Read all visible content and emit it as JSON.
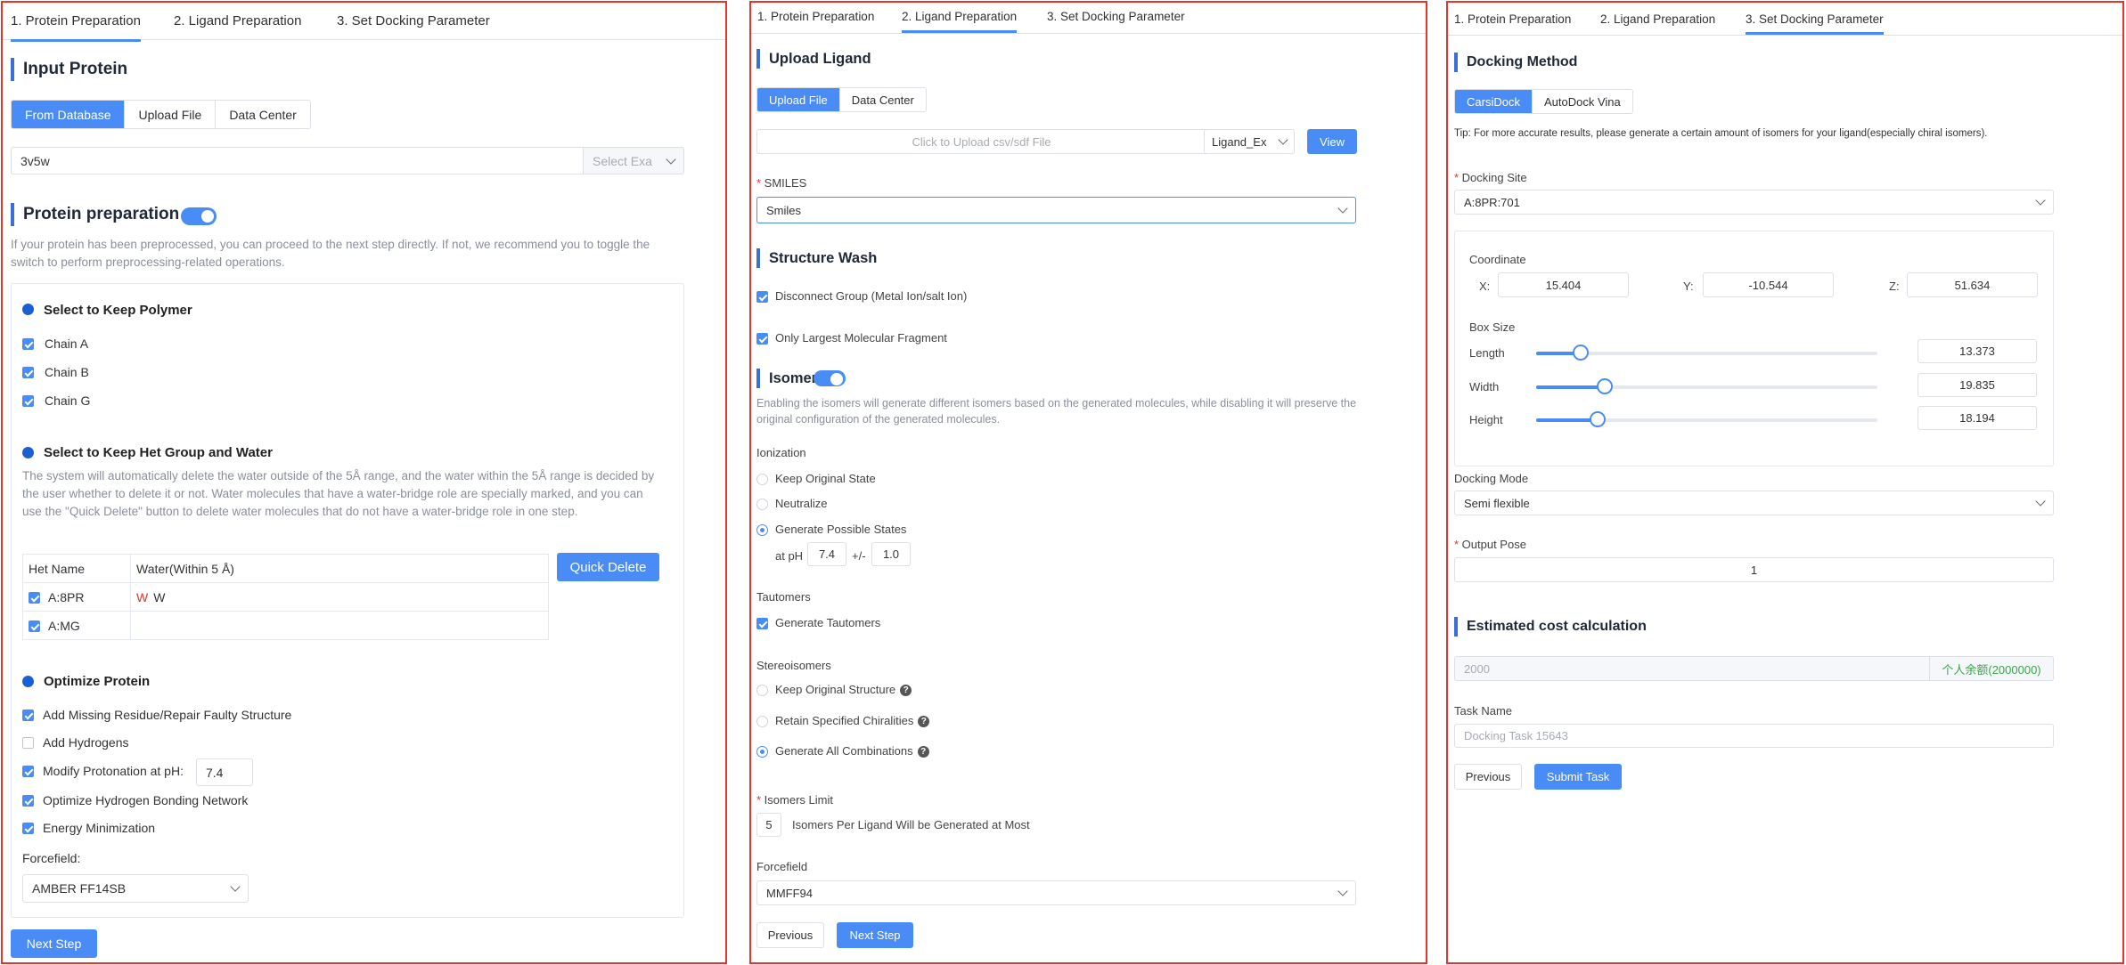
{
  "colors": {
    "accent": "#4a8cf6",
    "frame": "#e5342b",
    "success": "#3aa64a",
    "danger": "#e5342b"
  },
  "tabs": [
    "1. Protein Preparation",
    "2. Ligand Preparation",
    "3. Set Docking Parameter"
  ],
  "p1": {
    "input_protein_title": "Input Protein",
    "source_buttons": [
      "From Database",
      "Upload File",
      "Data Center"
    ],
    "pdb_id": "3v5w",
    "example_select": "Select Exa",
    "prep_title": "Protein preparation",
    "prep_desc": "If your protein has been preprocessed, you can proceed to the next step directly. If not, we recommend you to toggle the switch to perform preprocessing-related operations.",
    "polymer_title": "Select to Keep Polymer",
    "chains": [
      "Chain A",
      "Chain B",
      "Chain G"
    ],
    "het_title": "Select to Keep Het Group and Water",
    "het_desc": "The system will automatically delete the water outside of the 5Å range, and the water within the 5Å range is decided by the user whether to delete it or not. Water molecules that have a water-bridge role are specially marked, and you can use the \"Quick Delete\" button to delete water molecules that do not have a water-bridge role in one step.",
    "het_table": {
      "headers": [
        "Het Name",
        "Water(Within 5 Å)"
      ],
      "rows": [
        {
          "name": "A:8PR",
          "w_red": "W",
          "w": "W"
        },
        {
          "name": "A:MG",
          "w_red": "",
          "w": ""
        }
      ]
    },
    "quick_delete": "Quick Delete",
    "optimize_title": "Optimize Protein",
    "options": [
      {
        "label": "Add Missing Residue/Repair Faulty Structure",
        "checked": true
      },
      {
        "label": "Add Hydrogens",
        "checked": false
      },
      {
        "label": "Modify Protonation at pH:",
        "checked": true
      },
      {
        "label": "Optimize Hydrogen Bonding Network",
        "checked": true
      },
      {
        "label": "Energy Minimization",
        "checked": true
      }
    ],
    "ph_value": "7.4",
    "forcefield_label": "Forcefield:",
    "forcefield_value": "AMBER FF14SB",
    "next_button": "Next Step"
  },
  "p2": {
    "upload_title": "Upload Ligand",
    "source_buttons": [
      "Upload File",
      "Data Center"
    ],
    "upload_placeholder": "Click to Upload csv/sdf File",
    "example_select": "Ligand_Ex",
    "view_button": "View",
    "smiles_label": "SMILES",
    "smiles_value": "Smiles",
    "wash_title": "Structure Wash",
    "wash_options": [
      "Disconnect Group (Metal Ion/salt Ion)",
      "Only Largest Molecular Fragment"
    ],
    "isomers_title": "Isomers",
    "isomers_desc": "Enabling the isomers will generate different isomers based on the generated molecules, while disabling it will preserve the original configuration of the generated molecules.",
    "ionization_label": "Ionization",
    "ionization_options": [
      "Keep Original State",
      "Neutralize",
      "Generate Possible States"
    ],
    "at_ph": "at pH",
    "ph": "7.4",
    "pm": "+/-",
    "ph_range": "1.0",
    "tautomers_label": "Tautomers",
    "tautomers_option": "Generate Tautomers",
    "stereo_label": "Stereoisomers",
    "stereo_options": [
      "Keep Original Structure",
      "Retain Specified Chiralities",
      "Generate All Combinations"
    ],
    "limit_label": "Isomers Limit",
    "limit_value": "5",
    "limit_suffix": "Isomers Per Ligand Will be Generated at Most",
    "forcefield_label": "Forcefield",
    "forcefield_value": "MMFF94",
    "previous": "Previous",
    "next": "Next Step"
  },
  "p3": {
    "method_title": "Docking Method",
    "methods": [
      "CarsiDock",
      "AutoDock Vina"
    ],
    "tip": "Tip: For more accurate results, please generate a certain amount of isomers for your ligand(especially chiral isomers).",
    "site_label": "Docking Site",
    "site_value": "A:8PR:701",
    "coordinate_label": "Coordinate",
    "x_label": "X:",
    "x": "15.404",
    "y_label": "Y:",
    "y": "-10.544",
    "z_label": "Z:",
    "z": "51.634",
    "box_label": "Box Size",
    "box": [
      {
        "label": "Length",
        "value": "13.373",
        "level": 0.13
      },
      {
        "label": "Width",
        "value": "19.835",
        "level": 0.2
      },
      {
        "label": "Height",
        "value": "18.194",
        "level": 0.18
      }
    ],
    "mode_label": "Docking Mode",
    "mode_value": "Semi flexible",
    "pose_label": "Output Pose",
    "pose_value": "1",
    "cost_title": "Estimated cost calculation",
    "cost_value": "2000",
    "balance": "个人余额(2000000)",
    "task_label": "Task Name",
    "task_placeholder": "Docking Task 15643",
    "previous": "Previous",
    "submit": "Submit Task"
  }
}
